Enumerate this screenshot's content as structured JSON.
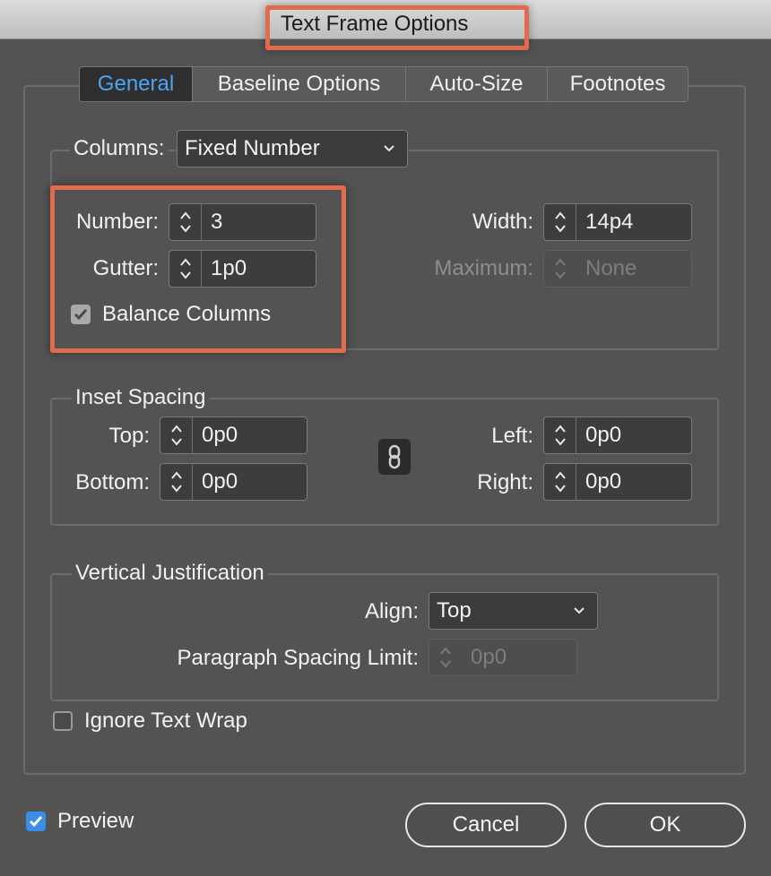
{
  "dialog": {
    "title": "Text Frame Options"
  },
  "tabs": [
    {
      "label": "General",
      "active": true
    },
    {
      "label": "Baseline Options",
      "active": false
    },
    {
      "label": "Auto-Size",
      "active": false
    },
    {
      "label": "Footnotes",
      "active": false
    }
  ],
  "columns": {
    "label": "Columns:",
    "type_value": "Fixed Number",
    "number_label": "Number:",
    "number_value": "3",
    "gutter_label": "Gutter:",
    "gutter_value": "1p0",
    "width_label": "Width:",
    "width_value": "14p4",
    "maximum_label": "Maximum:",
    "maximum_value": "None",
    "balance_label": "Balance Columns",
    "balance_checked": true
  },
  "inset": {
    "group_label": "Inset Spacing",
    "top_label": "Top:",
    "top_value": "0p0",
    "bottom_label": "Bottom:",
    "bottom_value": "0p0",
    "left_label": "Left:",
    "left_value": "0p0",
    "right_label": "Right:",
    "right_value": "0p0"
  },
  "vertical": {
    "group_label": "Vertical Justification",
    "align_label": "Align:",
    "align_value": "Top",
    "spacing_label": "Paragraph Spacing Limit:",
    "spacing_value": "0p0"
  },
  "ignore_wrap": {
    "label": "Ignore Text Wrap",
    "checked": false
  },
  "preview": {
    "label": "Preview",
    "checked": true
  },
  "buttons": {
    "cancel": "Cancel",
    "ok": "OK"
  },
  "colors": {
    "accent": "#4ea3f2",
    "highlight": "#e16b4f",
    "checkbox_blue": "#3a8ee6"
  },
  "icons": [
    "stepper-icon",
    "chevron-down-icon",
    "link-icon",
    "checkmark-icon"
  ]
}
